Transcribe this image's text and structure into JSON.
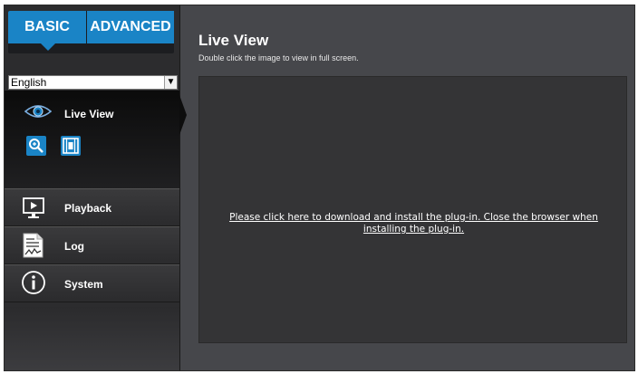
{
  "tabs": {
    "basic": "BASIC",
    "advanced": "ADVANCED"
  },
  "language": {
    "selected": "English"
  },
  "sidebar": {
    "live_view": {
      "label": "Live View",
      "icon": "eye-icon",
      "tools": [
        "zoom-icon",
        "film-icon"
      ]
    },
    "items": [
      {
        "label": "Playback",
        "icon": "playback-icon"
      },
      {
        "label": "Log",
        "icon": "log-icon"
      },
      {
        "label": "System",
        "icon": "info-icon"
      }
    ]
  },
  "main": {
    "title": "Live View",
    "subtitle": "Double click the image to view in full screen.",
    "plugin_message": "Please click here to download and install the plug-in. Close the browser when installing the plug-in."
  },
  "colors": {
    "accent": "#1a84c6",
    "panel_bg": "#46474b",
    "viewer_bg": "#343436"
  }
}
